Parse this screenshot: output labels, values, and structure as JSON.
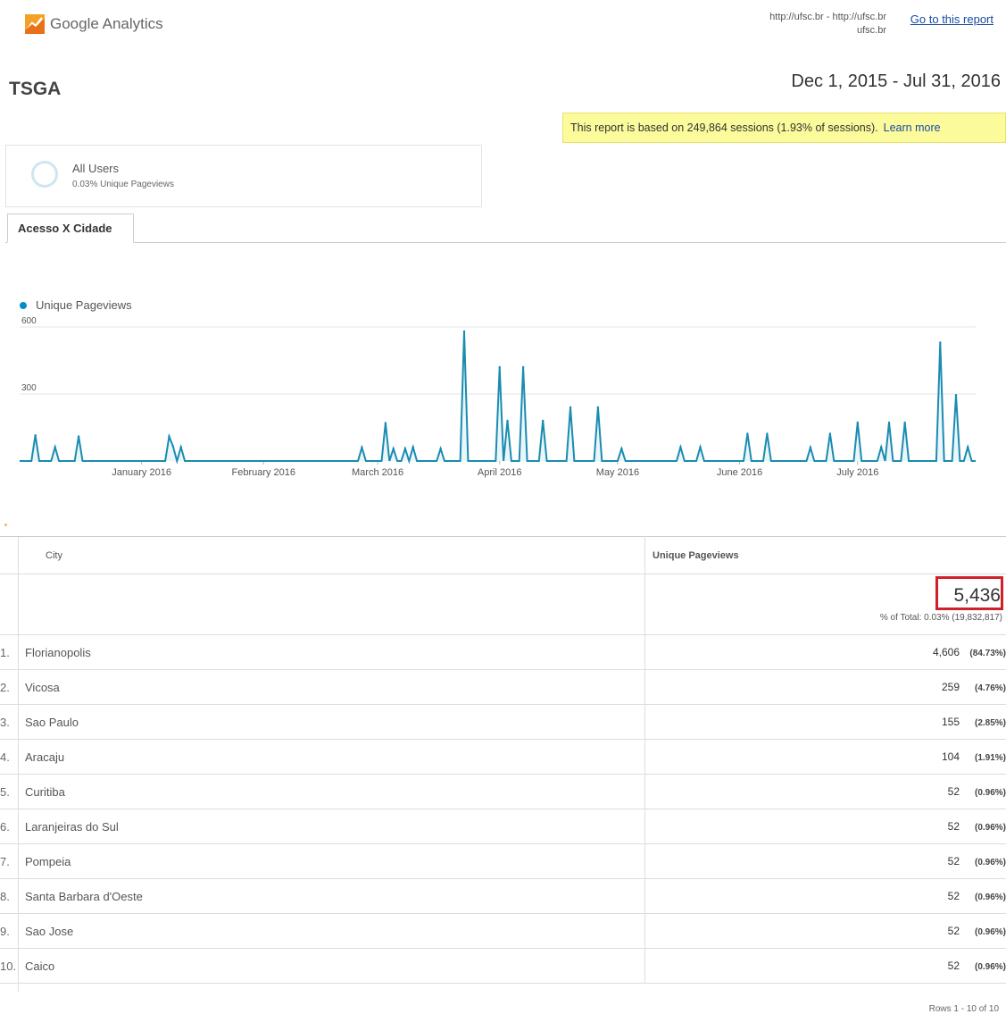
{
  "header": {
    "logo_text": "Google Analytics",
    "property_url_line1": "http://ufsc.br - http://ufsc.br",
    "property_url_line2": "ufsc.br",
    "goto_report_label": "Go to this report"
  },
  "report": {
    "title": "TSGA",
    "date_range": "Dec 1, 2015 - Jul 31, 2016"
  },
  "sampling": {
    "text": "This report is based on 249,864 sessions (1.93% of sessions).",
    "learn_more": "Learn more"
  },
  "segment": {
    "name": "All Users",
    "subtitle": "0.03% Unique Pageviews"
  },
  "tabs": [
    {
      "label": "Acesso X Cidade",
      "active": true
    }
  ],
  "chart_data": {
    "type": "line",
    "legend": "Unique Pageviews",
    "series_color": "#058dc7",
    "y_ticks": [
      "600",
      "300"
    ],
    "ylim": [
      0,
      600
    ],
    "x_labels": [
      "January 2016",
      "February 2016",
      "March 2016",
      "April 2016",
      "May 2016",
      "June 2016",
      "July 2016"
    ],
    "start_date": "2015-12-01",
    "end_date": "2016-07-31",
    "spikes": [
      {
        "x": "2015-12-05",
        "y": 115
      },
      {
        "x": "2015-12-10",
        "y": 62
      },
      {
        "x": "2015-12-16",
        "y": 110
      },
      {
        "x": "2016-01-08",
        "y": 110
      },
      {
        "x": "2016-01-09",
        "y": 65
      },
      {
        "x": "2016-01-11",
        "y": 62
      },
      {
        "x": "2016-02-26",
        "y": 60
      },
      {
        "x": "2016-03-03",
        "y": 170
      },
      {
        "x": "2016-03-05",
        "y": 55
      },
      {
        "x": "2016-03-08",
        "y": 55
      },
      {
        "x": "2016-03-10",
        "y": 62
      },
      {
        "x": "2016-03-17",
        "y": 55
      },
      {
        "x": "2016-03-23",
        "y": 580
      },
      {
        "x": "2016-04-01",
        "y": 420
      },
      {
        "x": "2016-04-03",
        "y": 180
      },
      {
        "x": "2016-04-07",
        "y": 420
      },
      {
        "x": "2016-04-12",
        "y": 180
      },
      {
        "x": "2016-04-19",
        "y": 240
      },
      {
        "x": "2016-04-26",
        "y": 240
      },
      {
        "x": "2016-05-02",
        "y": 55
      },
      {
        "x": "2016-05-17",
        "y": 62
      },
      {
        "x": "2016-05-22",
        "y": 62
      },
      {
        "x": "2016-06-03",
        "y": 122
      },
      {
        "x": "2016-06-08",
        "y": 122
      },
      {
        "x": "2016-06-19",
        "y": 60
      },
      {
        "x": "2016-06-24",
        "y": 122
      },
      {
        "x": "2016-07-01",
        "y": 172
      },
      {
        "x": "2016-07-07",
        "y": 62
      },
      {
        "x": "2016-07-09",
        "y": 172
      },
      {
        "x": "2016-07-13",
        "y": 172
      },
      {
        "x": "2016-07-22",
        "y": 530
      },
      {
        "x": "2016-07-26",
        "y": 295
      },
      {
        "x": "2016-07-29",
        "y": 62
      }
    ]
  },
  "table": {
    "headers": {
      "city": "City",
      "metric": "Unique Pageviews"
    },
    "total": {
      "value": "5,436",
      "pct": "% of Total: 0.03% (19,832,817)"
    },
    "rows": [
      {
        "rank": "1.",
        "city": "Florianopolis",
        "value": "4,606",
        "pct": "(84.73%)"
      },
      {
        "rank": "2.",
        "city": "Vicosa",
        "value": "259",
        "pct": "(4.76%)"
      },
      {
        "rank": "3.",
        "city": "Sao Paulo",
        "value": "155",
        "pct": "(2.85%)"
      },
      {
        "rank": "4.",
        "city": "Aracaju",
        "value": "104",
        "pct": "(1.91%)"
      },
      {
        "rank": "5.",
        "city": "Curitiba",
        "value": "52",
        "pct": "(0.96%)"
      },
      {
        "rank": "6.",
        "city": "Laranjeiras do Sul",
        "value": "52",
        "pct": "(0.96%)"
      },
      {
        "rank": "7.",
        "city": "Pompeia",
        "value": "52",
        "pct": "(0.96%)"
      },
      {
        "rank": "8.",
        "city": "Santa Barbara d'Oeste",
        "value": "52",
        "pct": "(0.96%)"
      },
      {
        "rank": "9.",
        "city": "Sao Jose",
        "value": "52",
        "pct": "(0.96%)"
      },
      {
        "rank": "10.",
        "city": "Caico",
        "value": "52",
        "pct": "(0.96%)"
      }
    ],
    "rows_info": "Rows 1 - 10 of 10"
  }
}
